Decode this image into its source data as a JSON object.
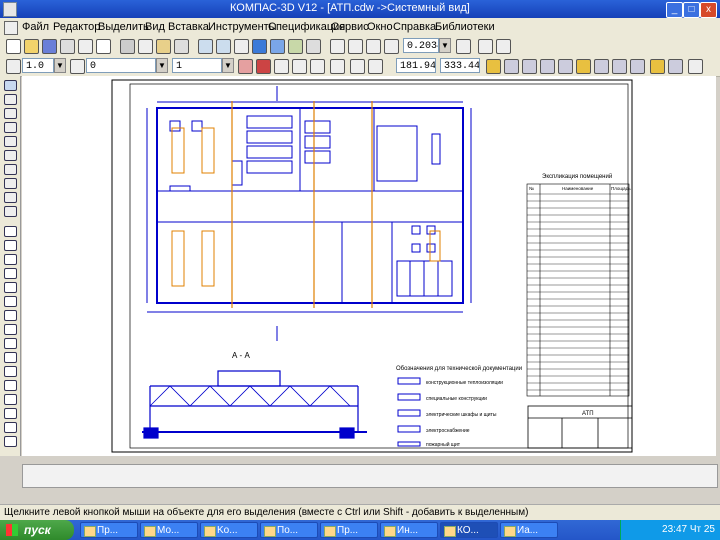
{
  "window": {
    "title": "КОМПАС-3D V12 - [АТП.cdw ->Системный вид]",
    "min": "_",
    "max": "□",
    "close": "x"
  },
  "menu": [
    "Файл",
    "Редактор",
    "Выделить",
    "Вид",
    "Вставка",
    "Инструменты",
    "Спецификация",
    "Сервис",
    "Окно",
    "Справка",
    "Библиотеки"
  ],
  "toolbar": {
    "zoom": "0.2034"
  },
  "props": {
    "style": "1.0",
    "layer": "0",
    "view": "1",
    "coord_x": "181.949",
    "coord_y": "333.446"
  },
  "drawing": {
    "caption": "А - А",
    "legend_title": "Обозначения для технической документации",
    "legend_items": [
      "конструкционные теплоизоляции",
      "специальные конструкции",
      "электрические шкафы и щиты",
      "электроснабжение",
      "пожарный щит"
    ],
    "table_title": "Экспликация помещений",
    "table_headers": [
      "№",
      "Наименование",
      "Площадь"
    ],
    "stamp_title": "АТП"
  },
  "statusbar": {
    "hint": "Щелкните левой кнопкой мыши на объекте для его выделения (вместе с Ctrl или Shift - добавить к выделенным)"
  },
  "taskbar": {
    "start": "пуск",
    "items": [
      "Пр...",
      "Мо...",
      "Ko...",
      "По...",
      "Пр...",
      "Ин...",
      "КО...",
      "Иа..."
    ],
    "clock": "23:47 Чт 25"
  },
  "colors": {
    "titlebar": "#1a4bc0",
    "drawing_lines": "#0000cc",
    "axis_lines": "#e08000",
    "taskbar": "#2a5fd0",
    "start": "#3a9a36"
  }
}
